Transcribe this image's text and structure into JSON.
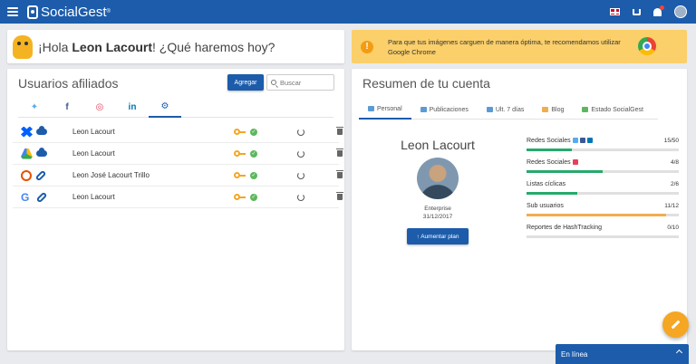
{
  "header": {
    "brand_name": "SocialGest",
    "brand_mark": "®"
  },
  "greeting": {
    "prefix": "¡Hola ",
    "name": "Leon Lacourt",
    "suffix": "! ¿Qué haremos hoy?"
  },
  "banner": {
    "text": "Para que tus imágenes carguen de manera óptima, te recomendamos utilizar Google Chrome"
  },
  "users_panel": {
    "title": "Usuarios afiliados",
    "add_label": "Agregar",
    "search_placeholder": "Buscar",
    "social_tabs": [
      "twitter",
      "facebook",
      "instagram",
      "linkedin",
      "settings"
    ],
    "rows": [
      {
        "service": "dropbox",
        "link": "cloud",
        "name": "Leon Lacourt"
      },
      {
        "service": "google-drive",
        "link": "cloud",
        "name": "Leon Lacourt"
      },
      {
        "service": "hashtracking",
        "link": "link",
        "name": "Leon José Lacourt Trillo"
      },
      {
        "service": "google",
        "link": "link",
        "name": "Leon Lacourt"
      }
    ]
  },
  "account_panel": {
    "title": "Resumen de tu cuenta",
    "tabs": [
      "Personal",
      "Publicaciones",
      "Ult. 7 días",
      "Blog",
      "Estado SocialGest"
    ],
    "profile": {
      "name": "Leon Lacourt",
      "plan": "Enterprise",
      "date": "31/12/2017",
      "upgrade_label": "Aumentar plan"
    },
    "stats": [
      {
        "label": "Redes Sociales",
        "count": "15/50",
        "fraction": 0.3,
        "color": "#26a96c"
      },
      {
        "label": "Redes Sociales",
        "count": "4/8",
        "fraction": 0.5,
        "color": "#26a96c"
      },
      {
        "label": "Listas cíclicas",
        "count": "2/6",
        "fraction": 0.333,
        "color": "#26a96c"
      },
      {
        "label": "Sub usuarios",
        "count": "11/12",
        "fraction": 0.917,
        "color": "#f0ad4e"
      },
      {
        "label": "Reportes de HashTracking",
        "count": "0/10",
        "fraction": 0,
        "color": "#26a96c"
      }
    ]
  },
  "chat": {
    "label": "En línea"
  }
}
